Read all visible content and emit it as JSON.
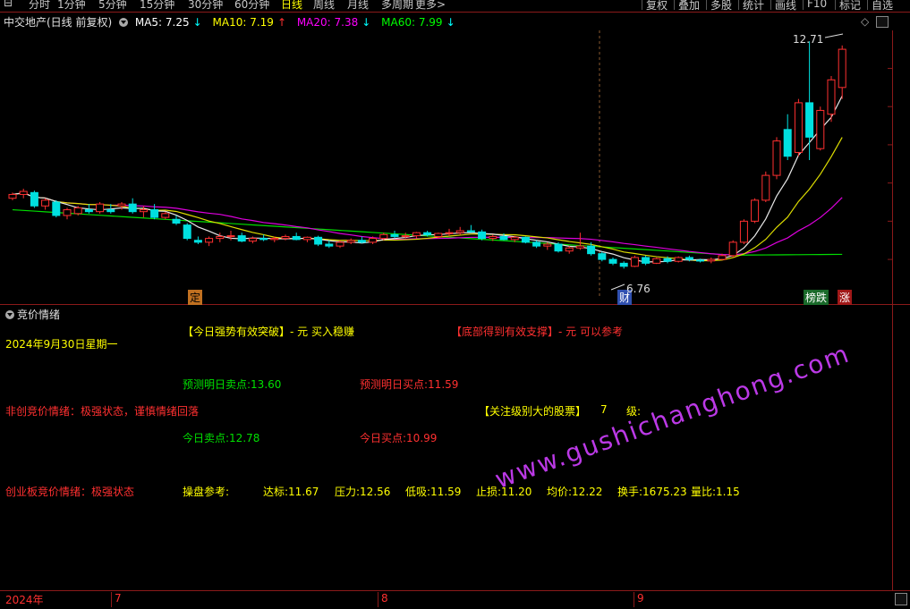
{
  "toolbar": {
    "periods": [
      "分时",
      "1分钟",
      "5分钟",
      "15分钟",
      "30分钟",
      "60分钟",
      "日线",
      "周线",
      "月线",
      "多周期",
      "更多>"
    ],
    "active": "日线",
    "right_buttons": [
      "复权",
      "叠加",
      "多股",
      "统计",
      "画线",
      "F10",
      "标记",
      "自选"
    ]
  },
  "header": {
    "title": "中交地产(日线 前复权)",
    "ma": [
      {
        "label": "MA5: 7.25",
        "arrow": "↓",
        "color": "#ffffff"
      },
      {
        "label": "MA10: 7.19",
        "arrow": "↑",
        "color": "#ffff00"
      },
      {
        "label": "MA20: 7.38",
        "arrow": "↓",
        "color": "#ff00ff"
      },
      {
        "label": "MA60: 7.99",
        "arrow": "↓",
        "color": "#00ff00"
      }
    ]
  },
  "markers": {
    "ding": "定",
    "cai": "财",
    "bangdie": "榜跌",
    "zhang": "涨",
    "high_label": "12.71",
    "low_label": "6.76"
  },
  "chart_data": {
    "type": "candlestick",
    "title": "中交地产(日线 前复权)",
    "ylim": [
      6.3,
      12.9
    ],
    "candles": [
      [
        8.6,
        8.75,
        8.55,
        8.7
      ],
      [
        8.7,
        8.85,
        8.6,
        8.78
      ],
      [
        8.75,
        8.8,
        8.35,
        8.4
      ],
      [
        8.4,
        8.6,
        8.3,
        8.55
      ],
      [
        8.5,
        8.55,
        8.1,
        8.15
      ],
      [
        8.15,
        8.35,
        8.05,
        8.3
      ],
      [
        8.2,
        8.4,
        8.15,
        8.35
      ],
      [
        8.3,
        8.45,
        8.2,
        8.25
      ],
      [
        8.25,
        8.5,
        8.2,
        8.45
      ],
      [
        8.3,
        8.45,
        8.2,
        8.25
      ],
      [
        8.4,
        8.5,
        8.3,
        8.45
      ],
      [
        8.45,
        8.6,
        8.2,
        8.25
      ],
      [
        8.25,
        8.4,
        8.1,
        8.3
      ],
      [
        8.3,
        8.45,
        8.05,
        8.1
      ],
      [
        8.1,
        8.25,
        8.05,
        8.2
      ],
      [
        8.05,
        8.15,
        7.9,
        7.95
      ],
      [
        7.9,
        7.95,
        7.5,
        7.55
      ],
      [
        7.5,
        7.6,
        7.4,
        7.45
      ],
      [
        7.45,
        7.6,
        7.35,
        7.55
      ],
      [
        7.55,
        7.7,
        7.45,
        7.6
      ],
      [
        7.6,
        7.75,
        7.5,
        7.62
      ],
      [
        7.62,
        7.7,
        7.45,
        7.48
      ],
      [
        7.48,
        7.6,
        7.42,
        7.55
      ],
      [
        7.55,
        7.65,
        7.48,
        7.52
      ],
      [
        7.52,
        7.6,
        7.45,
        7.55
      ],
      [
        7.55,
        7.65,
        7.5,
        7.6
      ],
      [
        7.6,
        7.7,
        7.5,
        7.52
      ],
      [
        7.52,
        7.6,
        7.45,
        7.58
      ],
      [
        7.58,
        7.62,
        7.35,
        7.4
      ],
      [
        7.4,
        7.5,
        7.3,
        7.35
      ],
      [
        7.35,
        7.5,
        7.3,
        7.45
      ],
      [
        7.45,
        7.55,
        7.4,
        7.5
      ],
      [
        7.5,
        7.6,
        7.42,
        7.45
      ],
      [
        7.45,
        7.6,
        7.4,
        7.55
      ],
      [
        7.55,
        7.7,
        7.5,
        7.65
      ],
      [
        7.65,
        7.75,
        7.55,
        7.6
      ],
      [
        7.6,
        7.7,
        7.55,
        7.62
      ],
      [
        7.62,
        7.72,
        7.55,
        7.7
      ],
      [
        7.7,
        7.75,
        7.6,
        7.65
      ],
      [
        7.6,
        7.7,
        7.55,
        7.68
      ],
      [
        7.68,
        7.8,
        7.6,
        7.7
      ],
      [
        7.7,
        7.85,
        7.65,
        7.75
      ],
      [
        7.75,
        7.9,
        7.7,
        7.72
      ],
      [
        7.72,
        7.78,
        7.5,
        7.55
      ],
      [
        7.55,
        7.65,
        7.48,
        7.6
      ],
      [
        7.6,
        7.68,
        7.5,
        7.52
      ],
      [
        7.52,
        7.62,
        7.45,
        7.58
      ],
      [
        7.58,
        7.6,
        7.42,
        7.45
      ],
      [
        7.45,
        7.5,
        7.3,
        7.35
      ],
      [
        7.35,
        7.45,
        7.25,
        7.4
      ],
      [
        7.4,
        7.45,
        7.18,
        7.22
      ],
      [
        7.22,
        7.35,
        7.15,
        7.3
      ],
      [
        7.3,
        7.7,
        7.25,
        7.35
      ],
      [
        7.35,
        7.45,
        7.1,
        7.15
      ],
      [
        7.15,
        7.2,
        6.95,
        7.0
      ],
      [
        7.0,
        7.05,
        6.85,
        6.9
      ],
      [
        6.9,
        6.95,
        6.76,
        6.82
      ],
      [
        6.82,
        7.1,
        6.8,
        7.05
      ],
      [
        7.05,
        7.1,
        6.85,
        6.9
      ],
      [
        6.9,
        7.05,
        6.88,
        7.02
      ],
      [
        7.02,
        7.08,
        6.9,
        6.95
      ],
      [
        6.95,
        7.08,
        6.92,
        7.05
      ],
      [
        7.05,
        7.1,
        6.95,
        7.0
      ],
      [
        6.98,
        7.02,
        6.92,
        6.96
      ],
      [
        6.96,
        7.05,
        6.9,
        7.0
      ],
      [
        7.0,
        7.15,
        6.98,
        7.1
      ],
      [
        7.1,
        7.5,
        7.05,
        7.45
      ],
      [
        7.45,
        8.05,
        7.4,
        8.0
      ],
      [
        8.0,
        8.6,
        7.95,
        8.55
      ],
      [
        8.55,
        9.3,
        8.5,
        9.2
      ],
      [
        9.2,
        10.2,
        9.1,
        10.1
      ],
      [
        10.4,
        10.8,
        9.6,
        9.7
      ],
      [
        9.8,
        11.2,
        9.7,
        11.1
      ],
      [
        11.1,
        12.71,
        9.6,
        10.2
      ],
      [
        9.9,
        11.0,
        9.85,
        10.9
      ],
      [
        10.8,
        11.8,
        10.6,
        11.7
      ],
      [
        11.5,
        12.6,
        11.2,
        12.5
      ]
    ],
    "ma5_last": 7.25,
    "ma10_last": 7.19,
    "ma20_last": 7.38,
    "ma60_last": 7.99,
    "x_labels": [
      "2024年",
      "7",
      "8",
      "9"
    ]
  },
  "panel": {
    "title": "竞价情绪",
    "date": "2024年9月30日星期一",
    "strong_break": "【今日强势有效突破】- 元 买入稳赚",
    "bottom_support": "【底部得到有效支撑】- 元 可以参考",
    "pred_sell": "预测明日卖点:13.60",
    "pred_buy": "预测明日买点:11.59",
    "non_chuang": "非创竞价情绪：极强状态，谨慎情绪回落",
    "focus": "【关注级别大的股票】",
    "focus_level": "7",
    "focus_level_unit": "级:",
    "today_sell": "今日卖点:12.78",
    "today_buy": "今日买点:10.99",
    "chuang": "创业板竞价情绪：极强状态",
    "ref_label": "操盘参考:",
    "ref_items": [
      "达标:11.67",
      "压力:12.56",
      "低吸:11.59",
      "止损:11.20",
      "均价:12.22",
      "换手:1675.23",
      "量比:1.15"
    ],
    "watermark": "www.gushichanghong.com"
  }
}
